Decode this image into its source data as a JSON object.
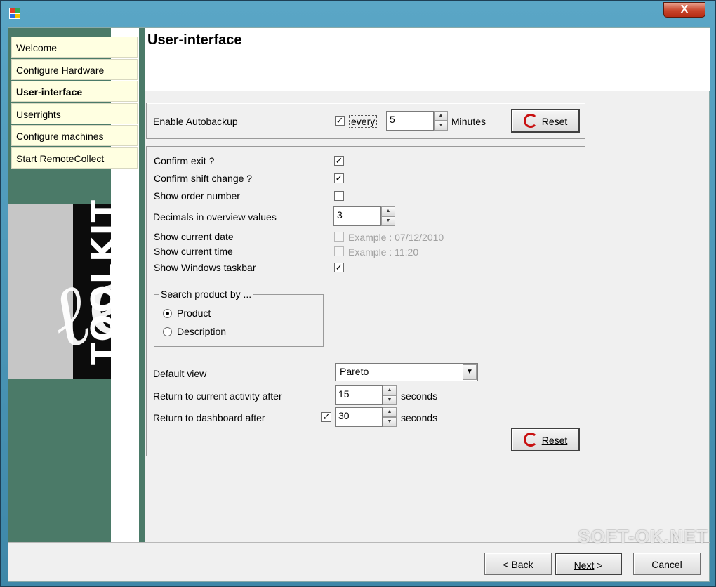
{
  "window": {
    "close_label": "X"
  },
  "sidebar": {
    "logo_text": "TOOLKIT",
    "items": [
      {
        "label": "Welcome"
      },
      {
        "label": "Configure Hardware"
      },
      {
        "label": "User-interface"
      },
      {
        "label": "Userrights"
      },
      {
        "label": "Configure machines"
      },
      {
        "label": "Start RemoteCollect"
      }
    ]
  },
  "header": {
    "title": "User-interface"
  },
  "autobackup": {
    "label": "Enable Autobackup",
    "checked": true,
    "every_label": "every",
    "value": "5",
    "unit": "Minutes",
    "reset_label": "Reset"
  },
  "settings": {
    "confirm_exit": {
      "label": "Confirm exit ?",
      "checked": true
    },
    "confirm_shift": {
      "label": "Confirm shift change ?",
      "checked": true
    },
    "show_order": {
      "label": "Show order number",
      "checked": false
    },
    "decimals": {
      "label": "Decimals in overview values",
      "value": "3"
    },
    "show_date": {
      "label": "Show current date",
      "example": "Example : 07/12/2010"
    },
    "show_time": {
      "label": "Show current time",
      "example": "Example : 11:20"
    },
    "show_taskbar": {
      "label": "Show Windows taskbar",
      "checked": true
    },
    "search_group": {
      "legend": "Search product by ...",
      "options": [
        {
          "label": "Product",
          "selected": true
        },
        {
          "label": "Description",
          "selected": false
        }
      ]
    },
    "default_view": {
      "label": "Default view",
      "value": "Pareto"
    },
    "return_activity": {
      "label": "Return to current activity after",
      "value": "15",
      "unit": "seconds"
    },
    "return_dashboard": {
      "label": "Return to dashboard after",
      "checked": true,
      "value": "30",
      "unit": "seconds"
    },
    "reset_label": "Reset"
  },
  "footer": {
    "back_label": "Back",
    "next_label": "Next",
    "cancel_label": "Cancel"
  },
  "watermark": "SOFT-OK.NET",
  "colors": {
    "sidebar_green": "#4b7a68",
    "nav_bg": "#ffffe1",
    "reset_icon": "#c81010"
  }
}
